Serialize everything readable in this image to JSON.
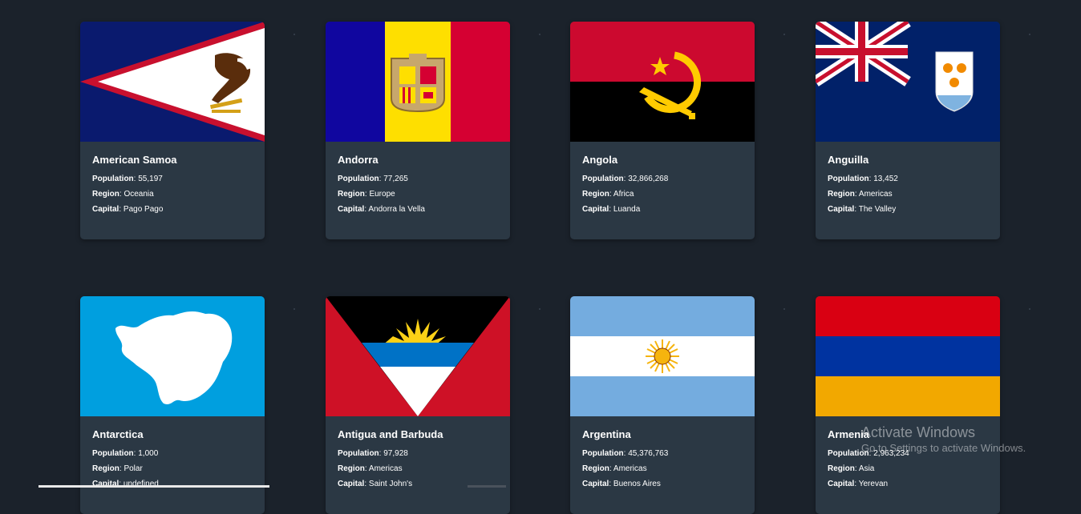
{
  "labels": {
    "population": "Population",
    "region": "Region",
    "capital": "Capital",
    "separator": ": "
  },
  "countries": [
    {
      "name": "American Samoa",
      "population": "55,197",
      "region": "Oceania",
      "capital": "Pago Pago",
      "flag_icon": "american-samoa-flag-icon"
    },
    {
      "name": "Andorra",
      "population": "77,265",
      "region": "Europe",
      "capital": "Andorra la Vella",
      "flag_icon": "andorra-flag-icon"
    },
    {
      "name": "Angola",
      "population": "32,866,268",
      "region": "Africa",
      "capital": "Luanda",
      "flag_icon": "angola-flag-icon"
    },
    {
      "name": "Anguilla",
      "population": "13,452",
      "region": "Americas",
      "capital": "The Valley",
      "flag_icon": "anguilla-flag-icon"
    },
    {
      "name": "Antarctica",
      "population": "1,000",
      "region": "Polar",
      "capital": "undefined",
      "flag_icon": "antarctica-flag-icon"
    },
    {
      "name": "Antigua and Barbuda",
      "population": "97,928",
      "region": "Americas",
      "capital": "Saint John's",
      "flag_icon": "antigua-and-barbuda-flag-icon"
    },
    {
      "name": "Argentina",
      "population": "45,376,763",
      "region": "Americas",
      "capital": "Buenos Aires",
      "flag_icon": "argentina-flag-icon"
    },
    {
      "name": "Armenia",
      "population": "2,963,234",
      "region": "Asia",
      "capital": "Yerevan",
      "flag_icon": "armenia-flag-icon"
    }
  ],
  "watermark": {
    "title": "Activate Windows",
    "subtitle": "Go to Settings to activate Windows."
  },
  "colors": {
    "background": "#1b222b",
    "card": "#2b3844",
    "text": "#ffffff"
  }
}
